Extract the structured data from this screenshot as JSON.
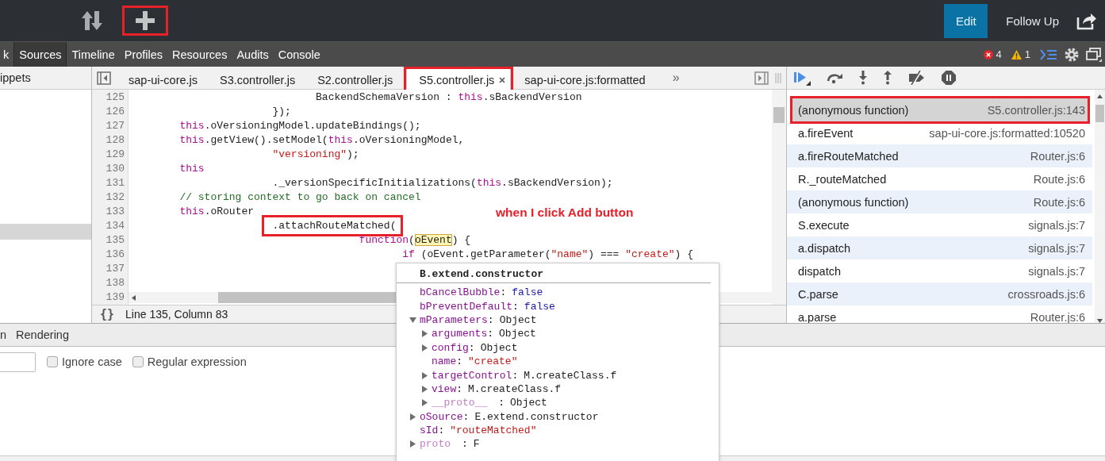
{
  "app_bar": {
    "tools": [
      {
        "kind": "sort",
        "annotated": false
      },
      {
        "kind": "add",
        "annotated": true
      }
    ],
    "edit_button": "Edit",
    "follow_up": "Follow Up"
  },
  "devtools": {
    "panels": [
      {
        "label": "k",
        "selected": false
      },
      {
        "label": "Sources",
        "selected": true
      },
      {
        "label": "Timeline",
        "selected": false
      },
      {
        "label": "Profiles",
        "selected": false
      },
      {
        "label": "Resources",
        "selected": false
      },
      {
        "label": "Audits",
        "selected": false
      },
      {
        "label": "Console",
        "selected": false
      }
    ],
    "error_count": "4",
    "warning_count": "1"
  },
  "navigator": {
    "tab": "ippets",
    "selected_row": true
  },
  "editor": {
    "tabs": [
      {
        "label": "sap-ui-core.js",
        "selected": false,
        "annotated": false
      },
      {
        "label": "S3.controller.js",
        "selected": false,
        "annotated": false
      },
      {
        "label": "S2.controller.js",
        "selected": false,
        "annotated": false
      },
      {
        "label": "S5.controller.js",
        "selected": true,
        "annotated": true
      },
      {
        "label": "sap-ui-core.js:formatted",
        "selected": false,
        "annotated": false
      }
    ],
    "overflow": "»",
    "lines": [
      {
        "number": "125",
        "kind": "property",
        "tokens": [
          {
            "kind": "plain",
            "text": "BackendSchemaVersion : "
          },
          {
            "kind": "keyword",
            "text": "this"
          },
          {
            "kind": "plain",
            "text": ".sBackendVersion"
          }
        ]
      },
      {
        "number": "126",
        "kind": "continuation",
        "tokens": [
          {
            "kind": "plain",
            "text": "});"
          }
        ]
      },
      {
        "number": "127",
        "kind": "statement",
        "tokens": [
          {
            "kind": "keyword",
            "text": "this"
          },
          {
            "kind": "plain",
            "text": ".oVersioningModel.updateBindings();"
          }
        ]
      },
      {
        "number": "128",
        "kind": "statement",
        "tokens": [
          {
            "kind": "keyword",
            "text": "this"
          },
          {
            "kind": "plain",
            "text": ".getView().setModel("
          },
          {
            "kind": "keyword",
            "text": "this"
          },
          {
            "kind": "plain",
            "text": ".oVersioningModel,"
          }
        ]
      },
      {
        "number": "129",
        "kind": "continuation",
        "tokens": [
          {
            "kind": "string",
            "text": "\"versioning\""
          },
          {
            "kind": "plain",
            "text": ");"
          }
        ]
      },
      {
        "number": "130",
        "kind": "statement",
        "tokens": [
          {
            "kind": "keyword",
            "text": "this"
          }
        ]
      },
      {
        "number": "131",
        "kind": "continuation",
        "tokens": [
          {
            "kind": "plain",
            "text": "._versionSpecificInitializations("
          },
          {
            "kind": "keyword",
            "text": "this"
          },
          {
            "kind": "plain",
            "text": ".sBackendVersion);"
          }
        ]
      },
      {
        "number": "132",
        "kind": "statement",
        "tokens": [
          {
            "kind": "comment",
            "text": "// storing context to go back on cancel"
          }
        ]
      },
      {
        "number": "133",
        "kind": "statement",
        "tokens": [
          {
            "kind": "keyword",
            "text": "this"
          },
          {
            "kind": "plain",
            "text": ".oRouter"
          }
        ]
      },
      {
        "number": "134",
        "kind": "continuation",
        "tokens": [
          {
            "kind": "annotated",
            "text": ".attachRouteMatched("
          }
        ]
      },
      {
        "number": "135",
        "kind": "argument",
        "tokens": [
          {
            "kind": "keyword",
            "text": "function"
          },
          {
            "kind": "plain",
            "text": "("
          },
          {
            "kind": "highlight",
            "text": "oEvent"
          },
          {
            "kind": "plain",
            "text": ") {"
          }
        ]
      },
      {
        "number": "136",
        "kind": "nested",
        "tokens": [
          {
            "kind": "keyword",
            "text": "if"
          },
          {
            "kind": "plain",
            "text": " (oEvent.getParameter("
          },
          {
            "kind": "string",
            "text": "\"name\""
          },
          {
            "kind": "plain",
            "text": ") === "
          },
          {
            "kind": "string",
            "text": "\"create\""
          },
          {
            "kind": "plain",
            "text": ") {"
          }
        ]
      },
      {
        "number": "137"
      },
      {
        "number": "138"
      },
      {
        "number": "139"
      }
    ],
    "format_icon": "{}",
    "status": "Line 135, Column 83"
  },
  "debugger": {
    "toolbar": [
      {
        "kind": "resume"
      },
      {
        "kind": "step-over"
      },
      {
        "kind": "step-into"
      },
      {
        "kind": "step-out"
      },
      {
        "kind": "deactivate"
      },
      {
        "kind": "pause"
      }
    ],
    "call_stack": [
      {
        "function": "(anonymous function)",
        "location": "S5.controller.js:143",
        "selected": true,
        "annotated": true
      },
      {
        "function": "a.fireEvent",
        "location": "sap-ui-core.js:formatted:10520",
        "selected": false,
        "annotated": false
      },
      {
        "function": "a.fireRouteMatched",
        "location": "Router.js:6",
        "selected": false,
        "annotated": false
      },
      {
        "function": "R._routeMatched",
        "location": "Route.js:6",
        "selected": false,
        "annotated": false
      },
      {
        "function": "(anonymous function)",
        "location": "Route.js:6",
        "selected": false,
        "annotated": false
      },
      {
        "function": "S.execute",
        "location": "signals.js:7",
        "selected": false,
        "annotated": false
      },
      {
        "function": "a.dispatch",
        "location": "signals.js:7",
        "selected": false,
        "annotated": false
      },
      {
        "function": "dispatch",
        "location": "signals.js:7",
        "selected": false,
        "annotated": false
      },
      {
        "function": "C.parse",
        "location": "crossroads.js:6",
        "selected": false,
        "annotated": false
      },
      {
        "function": "a.parse",
        "location": "Router.js:6",
        "selected": false,
        "annotated": false
      }
    ]
  },
  "drawer": {
    "tabs": [
      "n",
      "Rendering"
    ],
    "options": [
      {
        "label": "Ignore case",
        "checked": false
      },
      {
        "label": "Regular expression",
        "checked": false
      }
    ]
  },
  "popover": {
    "title": "B.extend.constructor",
    "properties": [
      {
        "name": "bCancelBubble",
        "separator": ":",
        "value": "false",
        "kind": "boolean"
      },
      {
        "name": "bPreventDefault",
        "separator": ":",
        "value": "false",
        "kind": "boolean"
      },
      {
        "name": "mParameters",
        "separator": ":",
        "value": "Object",
        "kind": "object",
        "expanded": true,
        "children": [
          {
            "name": "arguments",
            "separator": ":",
            "value": "Object",
            "kind": "object",
            "expanded": false
          },
          {
            "name": "config",
            "separator": ":",
            "value": "Object",
            "kind": "object",
            "expanded": false
          },
          {
            "name": "name",
            "separator": ":",
            "value": "\"create\"",
            "kind": "string"
          },
          {
            "name": "targetControl",
            "separator": ":",
            "value": "M.createClass.f",
            "kind": "object",
            "expanded": false
          },
          {
            "name": "view",
            "separator": ":",
            "value": "M.createClass.f",
            "kind": "object",
            "expanded": false
          },
          {
            "name": "__proto__",
            "separator": ":",
            "value": "Object",
            "kind": "object",
            "expanded": false,
            "internal": true
          }
        ]
      },
      {
        "name": "oSource",
        "separator": ":",
        "value": "E.extend.constructor",
        "kind": "object",
        "expanded": false
      },
      {
        "name": "sId",
        "separator": ":",
        "value": "\"routeMatched\"",
        "kind": "string"
      },
      {
        "name": "proto",
        "separator": ":",
        "value": "F",
        "kind": "object",
        "expanded": false,
        "internal": true
      }
    ]
  },
  "annotations": [
    {
      "text": "when I click Add button"
    }
  ]
}
